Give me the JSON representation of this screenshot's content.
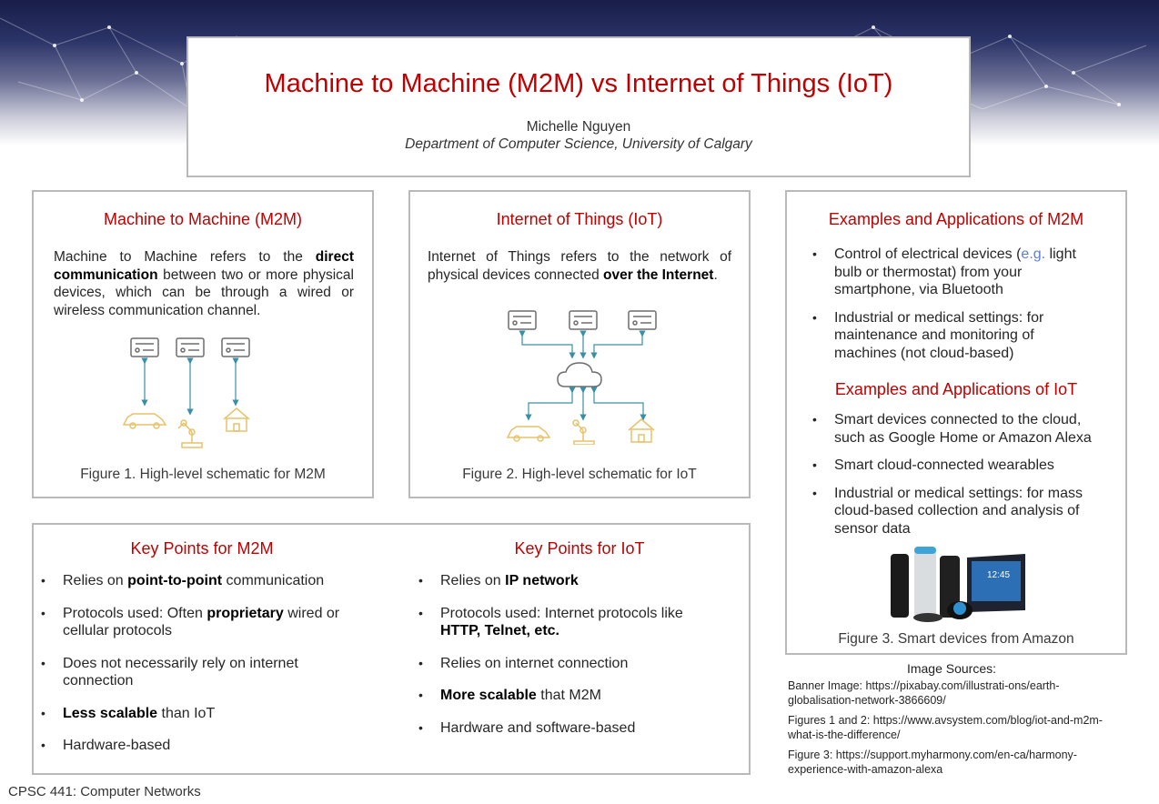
{
  "poster": {
    "title": "Machine to Machine (M2M) vs Internet of Things (IoT)",
    "author": "Michelle Nguyen",
    "department": "Department of Computer Science, University of Calgary"
  },
  "m2m": {
    "heading": "Machine to Machine (M2M)",
    "desc_1": "Machine to Machine refers to the ",
    "desc_bold": "direct communication",
    "desc_2": " between two or more physical devices, which can be through a wired or wireless communication channel.",
    "caption": "Figure 1. High-level schematic for M2M"
  },
  "iot": {
    "heading": "Internet of Things (IoT)",
    "desc_1": "Internet of Things refers to the network of physical devices connected ",
    "desc_bold": "over the Internet",
    "desc_2": ".",
    "caption": "Figure 2. High-level schematic for IoT"
  },
  "examples": {
    "m2m_heading": "Examples and Applications of M2M",
    "m2m_items": [
      {
        "pre": "Control of electrical devices (",
        "link": "e.g.",
        "post": " light bulb or thermostat) from your smartphone, via Bluetooth"
      },
      {
        "text": "Industrial or medical settings: for maintenance and monitoring of machines (not cloud-based)"
      }
    ],
    "iot_heading": "Examples and Applications of IoT",
    "iot_items": [
      "Smart devices connected to the cloud, such as Google Home or Amazon Alexa",
      "Smart cloud-connected wearables",
      "Industrial or medical settings: for mass cloud-based collection and analysis of sensor data"
    ],
    "echo_screen_time": "12:45",
    "caption": "Figure 3. Smart devices from Amazon"
  },
  "keypoints": {
    "m2m_heading": "Key Points for M2M",
    "iot_heading": "Key Points for IoT",
    "m2m": [
      {
        "pre": "Relies on ",
        "bold": "point-to-point",
        "post": " communication"
      },
      {
        "pre": "Protocols used: Often ",
        "bold": "proprietary",
        "post": " wired or cellular protocols"
      },
      {
        "pre": "Does not necessarily rely on internet connection",
        "bold": "",
        "post": ""
      },
      {
        "pre": "",
        "bold": "Less scalable",
        "post": " than IoT"
      },
      {
        "pre": "Hardware-based",
        "bold": "",
        "post": ""
      }
    ],
    "iot": [
      {
        "pre": "Relies on ",
        "bold": "IP network",
        "post": ""
      },
      {
        "pre": "Protocols used: Internet protocols like ",
        "bold": "HTTP, Telnet, etc.",
        "post": ""
      },
      {
        "pre": "Relies on internet connection",
        "bold": "",
        "post": ""
      },
      {
        "pre": "",
        "bold": "More scalable",
        "post": " that M2M"
      },
      {
        "pre": "Hardware and software-based",
        "bold": "",
        "post": ""
      }
    ]
  },
  "sources": {
    "title": "Image Sources:",
    "banner": "Banner Image: https://pixabay.com/illustrati-ons/earth-globalisation-network-3866609/",
    "figures12": "Figures 1 and 2: https://www.avsystem.com/blog/iot-and-m2m-what-is-the-difference/",
    "figure3": "Figure 3: https://support.myharmony.com/en-ca/harmony-experience-with-amazon-alexa"
  },
  "footer": "CPSC 441: Computer Networks",
  "colors": {
    "heading_red": "#c00000",
    "arrow_teal": "#3a8fa8",
    "icon_yellow": "#e8c16a",
    "icon_gray": "#6d6d6d"
  }
}
